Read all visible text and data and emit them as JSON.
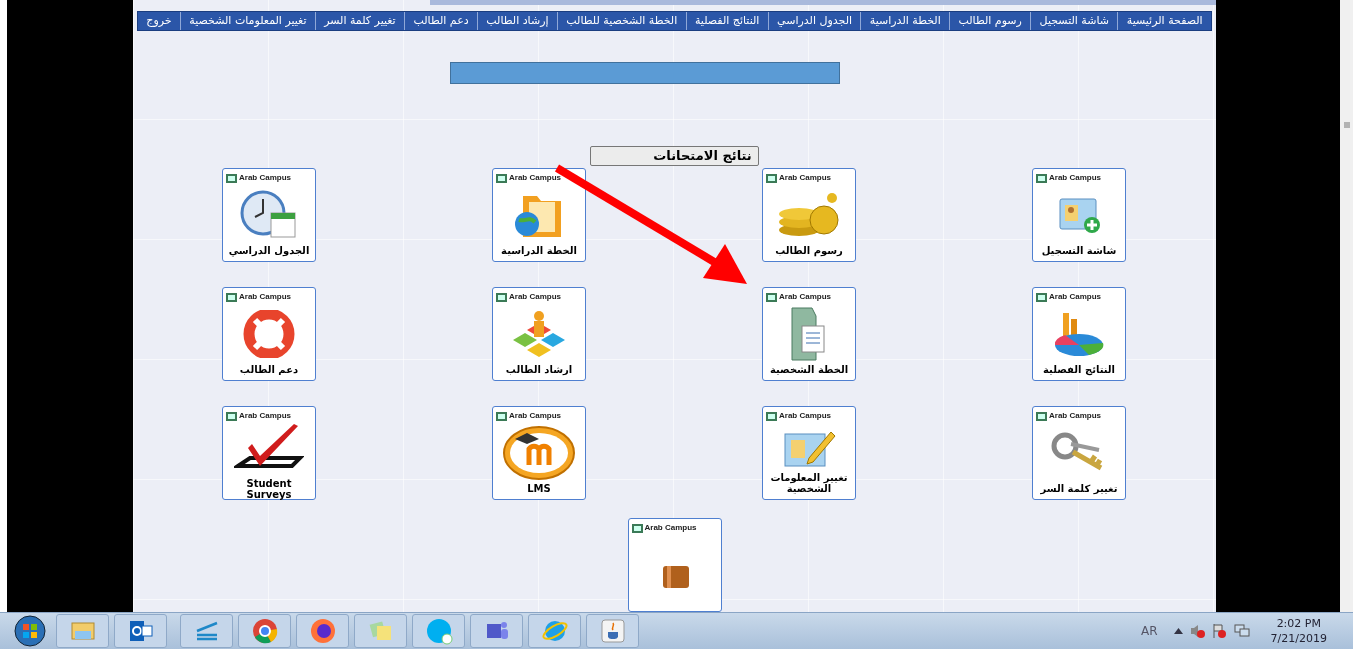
{
  "menu": [
    {
      "label": "الصفحة الرئيسية"
    },
    {
      "label": "شاشة التسجيل"
    },
    {
      "label": "رسوم الطالب"
    },
    {
      "label": "الخطة الدراسية"
    },
    {
      "label": "الجدول الدراسي"
    },
    {
      "label": "النتائج الفصلية"
    },
    {
      "label": "الخطة الشخصية للطالب"
    },
    {
      "label": "إرشاد الطالب"
    },
    {
      "label": "دعم الطالب"
    },
    {
      "label": "تغيير كلمة السر"
    },
    {
      "label": "تغيير المعلومات الشخصية"
    },
    {
      "label": "خروج"
    }
  ],
  "heading_button": "نتائج الامتحانات",
  "tiles": [
    {
      "brand": "Arab Campus",
      "label": "شاشة التسجيل"
    },
    {
      "brand": "Arab Campus",
      "label": "رسوم الطالب"
    },
    {
      "brand": "Arab Campus",
      "label": "الخطة الدراسية"
    },
    {
      "brand": "Arab Campus",
      "label": "الجدول الدراسي"
    },
    {
      "brand": "Arab Campus",
      "label": "النتائج الفصلية"
    },
    {
      "brand": "Arab Campus",
      "label": "الخطة الشخصية"
    },
    {
      "brand": "Arab Campus",
      "label": "ارشاد الطالب"
    },
    {
      "brand": "Arab Campus",
      "label": "دعم الطالب"
    },
    {
      "brand": "Arab Campus",
      "label": "تغيير كلمة السر"
    },
    {
      "brand": "Arab Campus",
      "label": "تغيير المعلومات الشخصية"
    },
    {
      "brand": "Arab Campus",
      "label": "LMS"
    },
    {
      "brand": "Arab Campus",
      "label": "Student Surveys"
    },
    {
      "brand": "Arab Campus"
    }
  ],
  "taskbar": {
    "language": "AR",
    "time": "2:02 PM",
    "date": "7/21/2019"
  }
}
